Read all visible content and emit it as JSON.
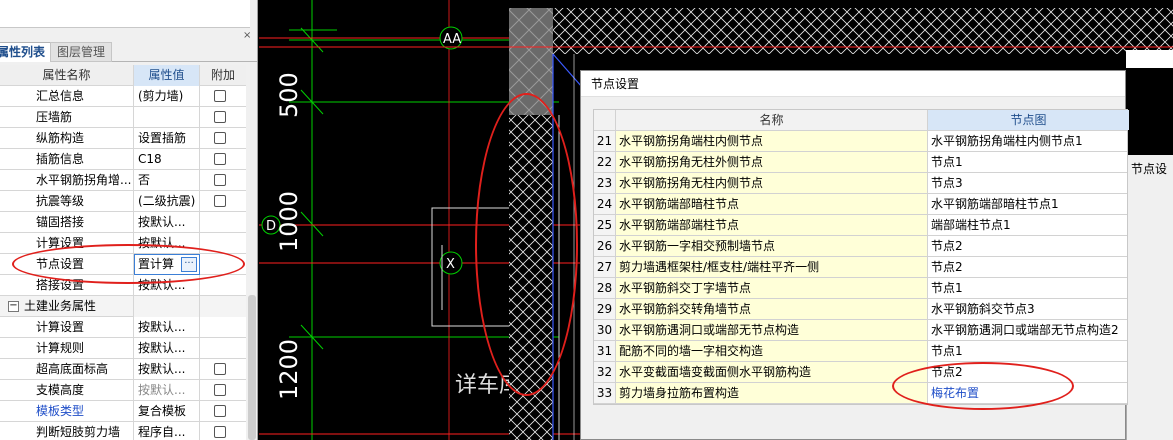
{
  "left_panel": {
    "tabs": [
      "属性列表",
      "图层管理"
    ],
    "close_glyph": "×",
    "header": {
      "name": "属性名称",
      "value": "属性值",
      "add": "附加"
    },
    "rows": [
      {
        "num": "",
        "name": "汇总信息",
        "value": "(剪力墙)",
        "checkbox": true
      },
      {
        "num": "",
        "name": "压墙筋",
        "value": "",
        "checkbox": true
      },
      {
        "num": "",
        "name": "纵筋构造",
        "value": "设置插筋",
        "checkbox": true
      },
      {
        "num": "",
        "name": "插筋信息",
        "value": "C18",
        "checkbox": true
      },
      {
        "num": "",
        "name": "水平钢筋拐角增...",
        "value": "否",
        "checkbox": true
      },
      {
        "num": "",
        "name": "抗震等级",
        "value": "(二级抗震)",
        "checkbox": true
      },
      {
        "num": "",
        "name": "锚固搭接",
        "value": "按默认...",
        "checkbox": false
      },
      {
        "num": "",
        "name": "计算设置",
        "value": "按默认...",
        "checkbox": false
      },
      {
        "num": "",
        "name": "节点设置",
        "value": "置计算",
        "checkbox": false,
        "editing": true
      },
      {
        "num": "",
        "name": "搭接设置",
        "value": "按默认...",
        "checkbox": false
      }
    ],
    "section": "土建业务属性",
    "section_rows": [
      {
        "name": "计算设置",
        "value": "按默认...",
        "checkbox": false
      },
      {
        "name": "计算规则",
        "value": "按默认...",
        "checkbox": false
      },
      {
        "name": "超高底面标高",
        "value": "按默认...",
        "checkbox": true
      },
      {
        "name": "支模高度",
        "value": "按默认...",
        "checkbox": true,
        "muted": true
      },
      {
        "name": "模板类型",
        "value": "复合模板",
        "checkbox": true,
        "link": true
      },
      {
        "name": "判断短肢剪力墙",
        "value": "程序自...",
        "checkbox": true
      }
    ],
    "ellipsis": "···"
  },
  "cad": {
    "axis_labels": [
      "AA",
      "D",
      "X"
    ],
    "dims": [
      "500",
      "1000",
      "1200"
    ],
    "room_text": "详车库"
  },
  "dialog": {
    "title": "节点设置",
    "columns": {
      "name": "名称",
      "node": "节点图"
    },
    "rows": [
      {
        "num": "21",
        "name": "水平钢筋拐角端柱内侧节点",
        "node": "水平钢筋拐角端柱内侧节点1"
      },
      {
        "num": "22",
        "name": "水平钢筋拐角无柱外侧节点",
        "node": "节点1"
      },
      {
        "num": "23",
        "name": "水平钢筋拐角无柱内侧节点",
        "node": "节点3"
      },
      {
        "num": "24",
        "name": "水平钢筋端部暗柱节点",
        "node": "水平钢筋端部暗柱节点1"
      },
      {
        "num": "25",
        "name": "水平钢筋端部端柱节点",
        "node": "端部端柱节点1"
      },
      {
        "num": "26",
        "name": "水平钢筋一字相交预制墙节点",
        "node": "节点2"
      },
      {
        "num": "27",
        "name": "剪力墙遇框架柱/框支柱/端柱平齐一侧",
        "node": "节点2"
      },
      {
        "num": "28",
        "name": "水平钢筋斜交丁字墙节点",
        "node": "节点1"
      },
      {
        "num": "29",
        "name": "水平钢筋斜交转角墙节点",
        "node": "水平钢筋斜交节点3"
      },
      {
        "num": "30",
        "name": "水平钢筋遇洞口或端部无节点构造",
        "node": "水平钢筋遇洞口或端部无节点构造2"
      },
      {
        "num": "31",
        "name": "配筋不同的墙一字相交构造",
        "node": "节点1"
      },
      {
        "num": "32",
        "name": "水平变截面墙变截面侧水平钢筋构造",
        "node": "节点2"
      },
      {
        "num": "33",
        "name": "剪力墙身拉筋布置构造",
        "node": "梅花布置",
        "link": true
      }
    ]
  },
  "side_panel": {
    "label": "节点设"
  },
  "colors": {
    "accent": "#1f4e8c",
    "annotation": "#e0201c",
    "cad_green": "#00d000",
    "cad_red": "#ff2020"
  }
}
